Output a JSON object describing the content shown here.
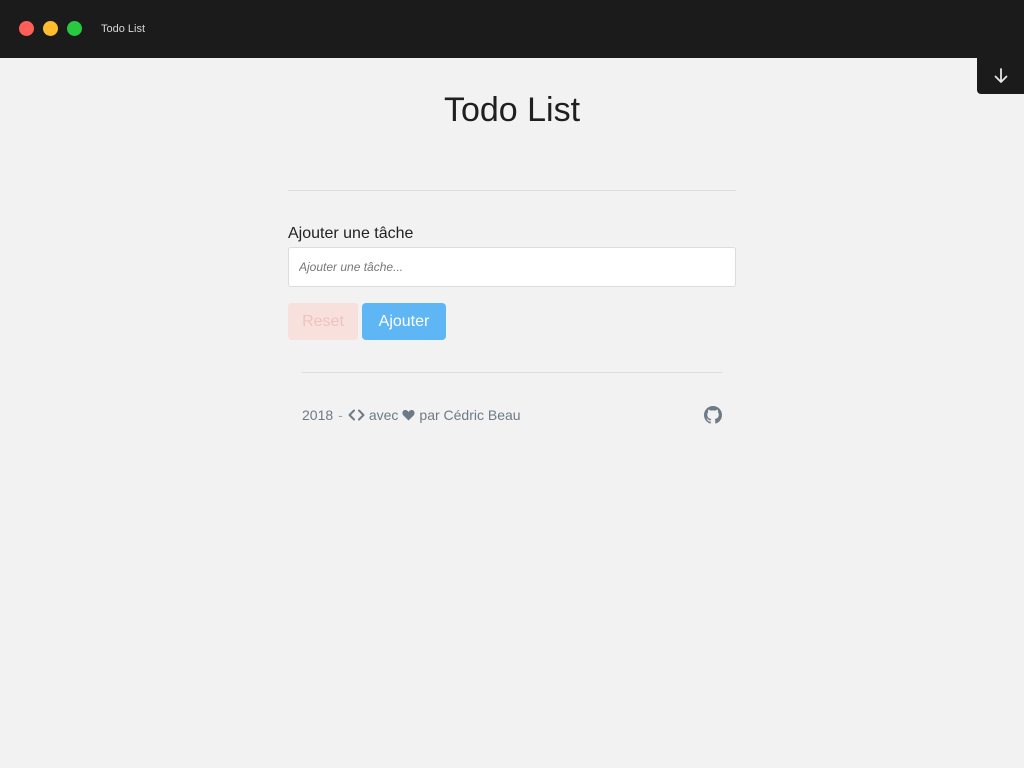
{
  "window": {
    "title": "Todo List",
    "controls": [
      "close",
      "minimize",
      "maximize"
    ]
  },
  "toolbar": {
    "download_icon": "arrow-down-icon"
  },
  "page": {
    "title": "Todo List"
  },
  "form": {
    "label": "Ajouter une tâche",
    "input_value": "",
    "input_placeholder": "Ajouter une tâche...",
    "reset_label": "Reset",
    "add_label": "Ajouter"
  },
  "footer": {
    "year": "2018",
    "separator": "-",
    "code_icon": "code-icon",
    "avec": "avec",
    "heart_icon": "heart-icon",
    "par_author": "par Cédric Beau",
    "github_icon": "github-icon"
  },
  "colors": {
    "titlebar_bg": "#1b1b1b",
    "page_bg": "#f2f2f2",
    "add_button": "#5eb6f5",
    "reset_button": "#f8e0dc",
    "footer_text": "#6d7a87"
  }
}
